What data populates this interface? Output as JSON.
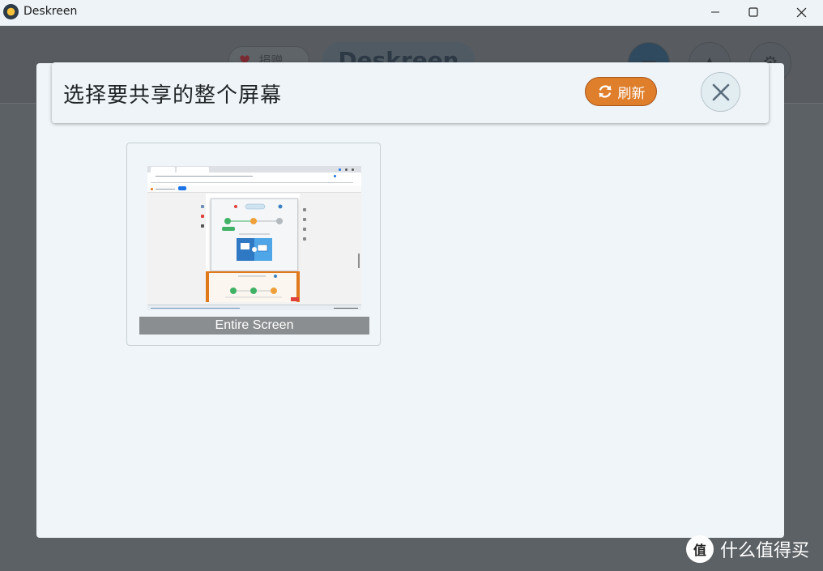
{
  "window": {
    "title": "Deskreen",
    "minimize_glyph": "—",
    "maximize_glyph": "☐",
    "close_glyph": "✕"
  },
  "background_app": {
    "donate_label": "捐赠",
    "logo_text": "Deskreen"
  },
  "dialog": {
    "title": "选择要共享的整个屏幕",
    "refresh_label": "刷新",
    "refresh_icon": "refresh-icon",
    "close_icon": "close-icon",
    "screens": [
      {
        "label": "Entire Screen"
      }
    ]
  },
  "watermark": {
    "badge_text": "值",
    "text": "什么值得买"
  },
  "colors": {
    "accent": "#df7e2b",
    "dialog_bg": "#eff5f8",
    "overlay": "#5c6165",
    "caption_bg": "#8b8e90"
  }
}
